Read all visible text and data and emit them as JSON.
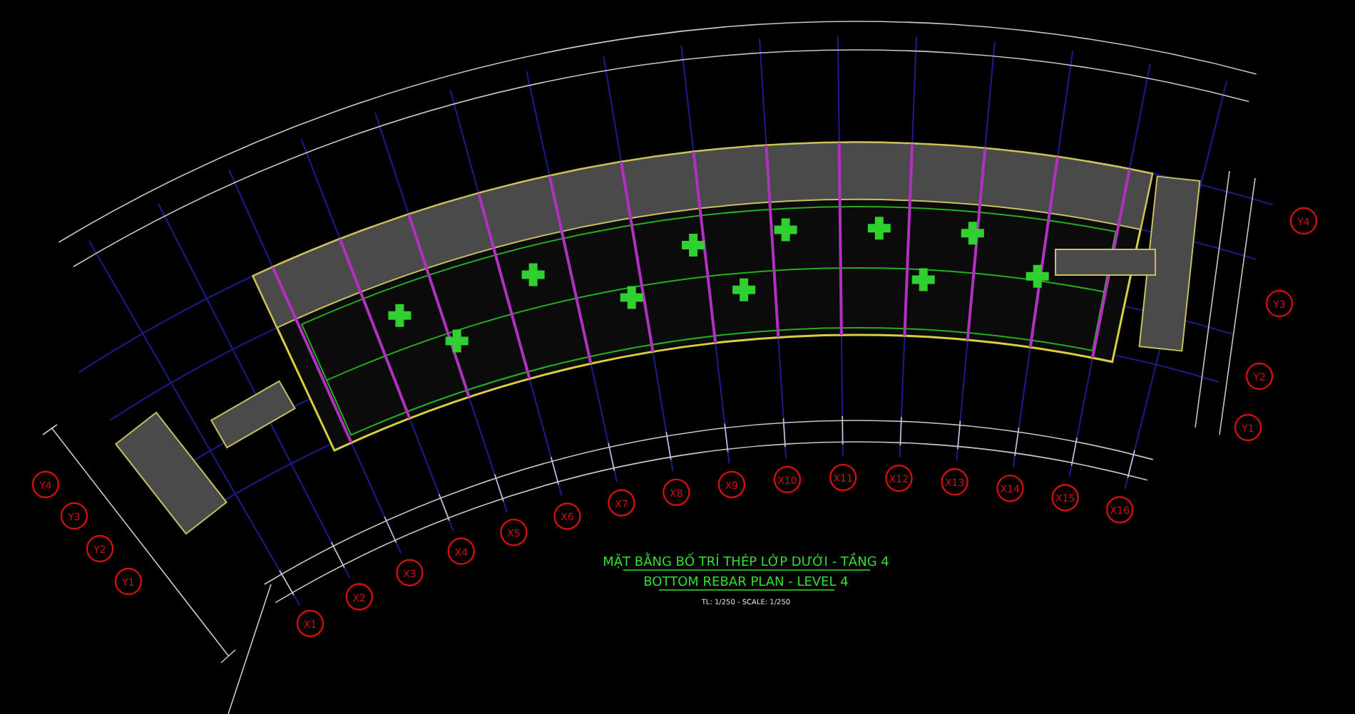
{
  "drawing": {
    "title": "MẶT BẰNG BỐ TRÍ THÉP LỚP DƯỚI - TẦNG 4",
    "subtitle": "BOTTOM REBAR PLAN - LEVEL 4",
    "scale": "TL: 1/250 - SCALE: 1/250",
    "bottom_bubbles": [
      "X1",
      "X2",
      "X3",
      "X4",
      "X5",
      "X6",
      "X7",
      "X8",
      "X9",
      "X10",
      "X11",
      "X12",
      "X13",
      "X14",
      "X15",
      "X16"
    ],
    "right_bubbles": [
      "Y4",
      "Y3",
      "Y2",
      "Y1"
    ],
    "left_bubbles": [
      "Y4",
      "Y3",
      "Y2",
      "Y1"
    ]
  }
}
